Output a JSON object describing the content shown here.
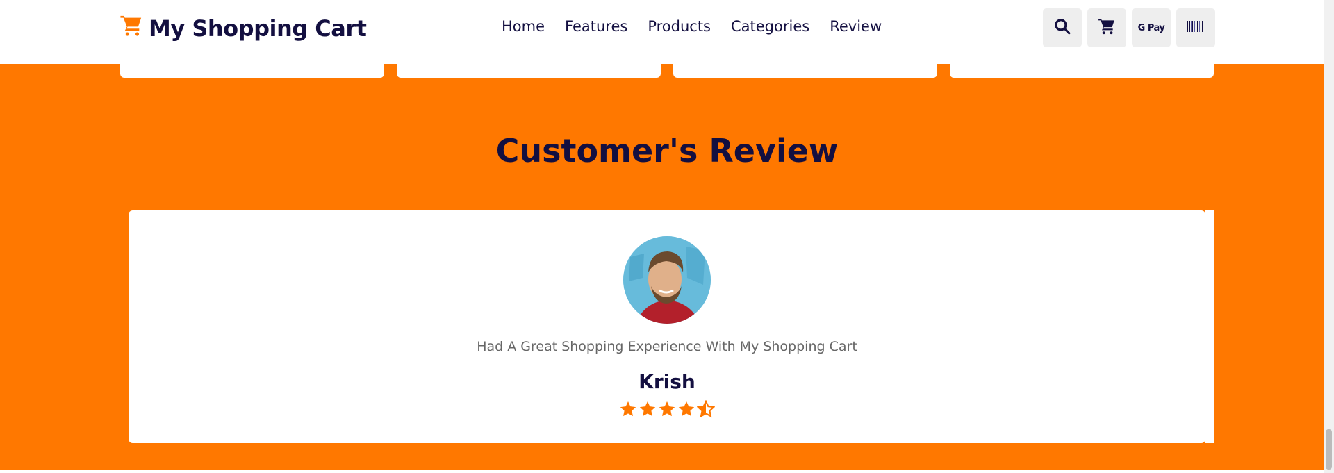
{
  "header": {
    "logo_text": "My Shopping Cart",
    "nav": [
      {
        "label": "Home"
      },
      {
        "label": "Features"
      },
      {
        "label": "Products"
      },
      {
        "label": "Categories"
      },
      {
        "label": "Review"
      }
    ],
    "icons": [
      "search-icon",
      "cart-icon",
      "gpay-icon",
      "barcode-icon"
    ],
    "gpay_label": "G Pay"
  },
  "colors": {
    "accent": "#ff7800",
    "dark": "#130f40",
    "muted": "#666666",
    "icon_bg": "#eeeeee"
  },
  "review_section": {
    "title": "Customer's Review",
    "review": {
      "text": "Had A Great Shopping Experience With My Shopping Cart",
      "name": "Krish",
      "rating": 4.5,
      "rating_max": 5
    }
  }
}
